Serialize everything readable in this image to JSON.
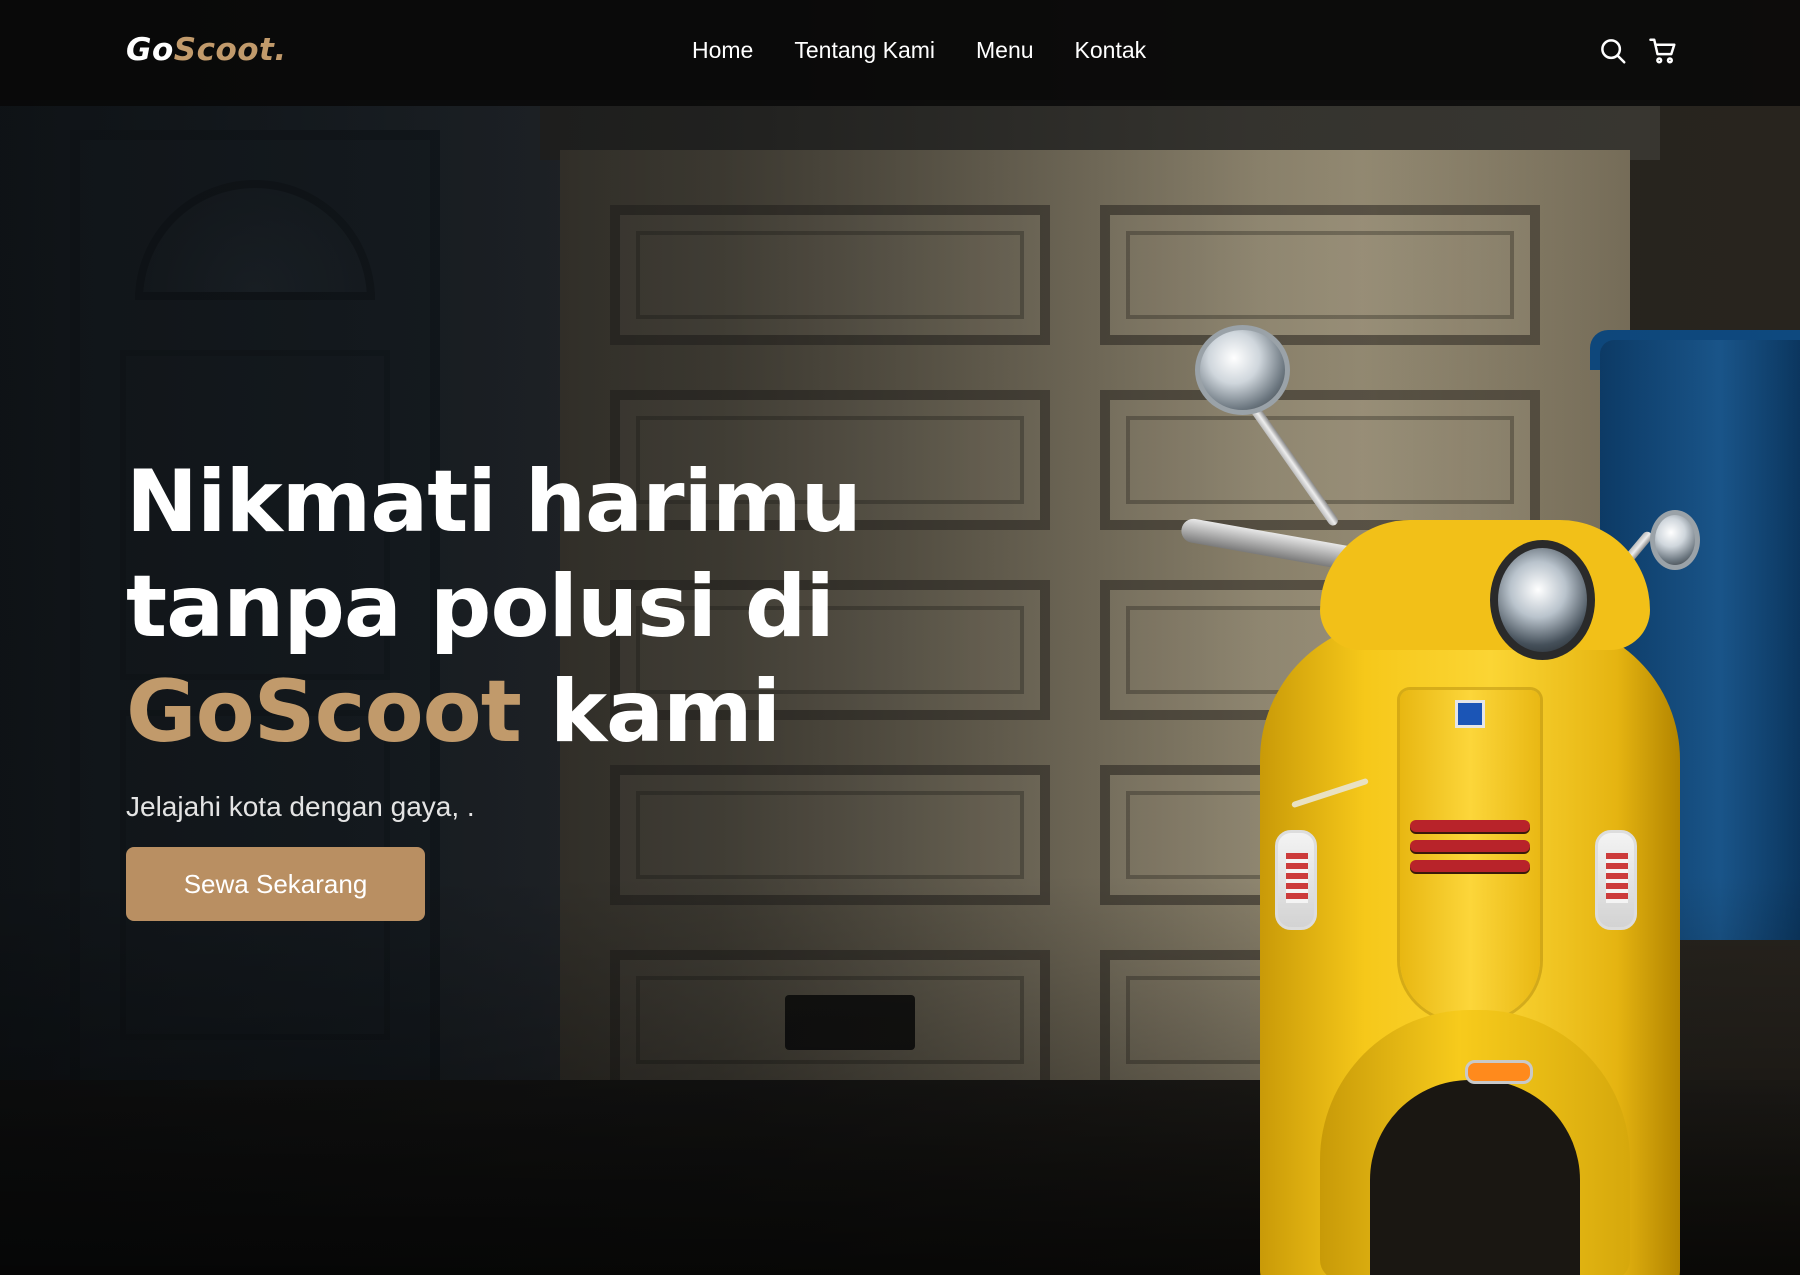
{
  "brand": {
    "part1": "Go",
    "part2": "Scoot."
  },
  "nav": {
    "links": [
      "Home",
      "Tentang Kami",
      "Menu",
      "Kontak"
    ],
    "icons": [
      "search-icon",
      "cart-icon"
    ]
  },
  "hero": {
    "title_line1": "Nikmati harimu",
    "title_line2": "tanpa polusi di",
    "title_accent": "GoScoot",
    "title_end": " kami",
    "subtitle": "Jelajahi kota dengan gaya, .",
    "cta_label": "Sewa Sekarang",
    "background_image": "yellow-vespa-scooter-in-front-of-garage"
  },
  "colors": {
    "accent": "#c19a6b",
    "button": "#b98f62",
    "navbar": "#080808",
    "text": "#ffffff"
  }
}
